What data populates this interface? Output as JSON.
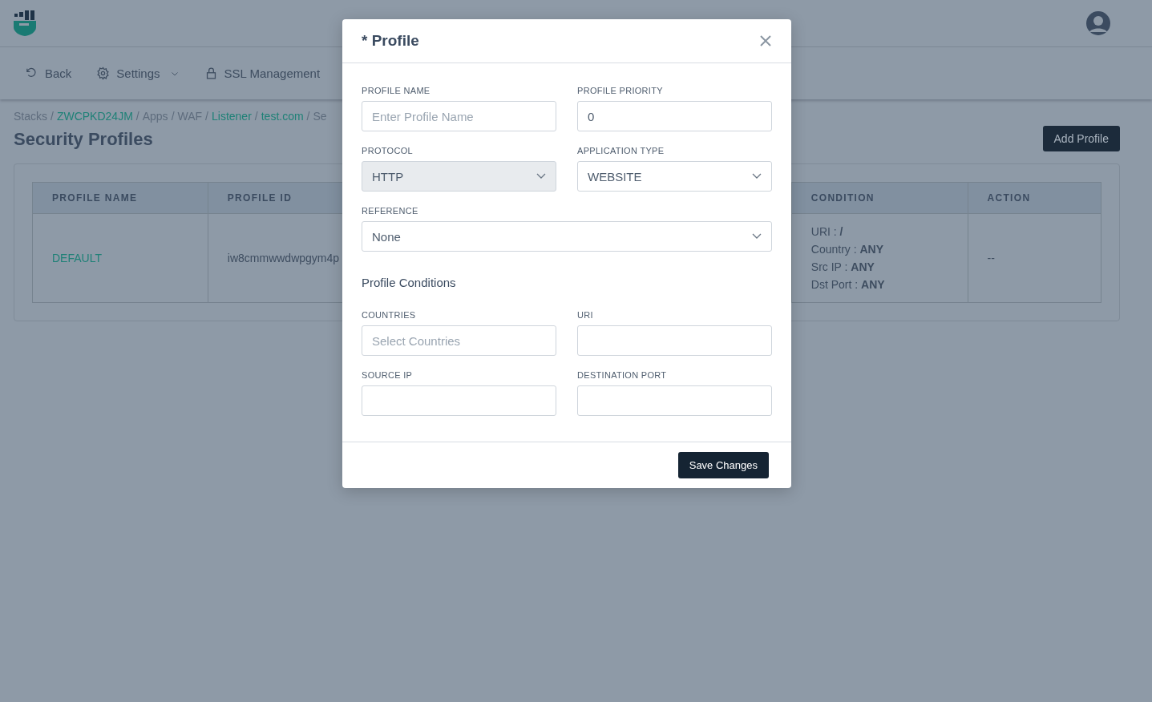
{
  "nav": [
    {
      "label": "Back",
      "dropdown": false
    },
    {
      "label": "Settings",
      "dropdown": true
    },
    {
      "label": "SSL Management",
      "dropdown": false
    }
  ],
  "breadcrumb": [
    {
      "label": "Stacks",
      "link": false
    },
    {
      "label": "ZWCPKD24JM",
      "link": true
    },
    {
      "label": "Apps",
      "link": false
    },
    {
      "label": "WAF",
      "link": false
    },
    {
      "label": "Listener",
      "link": true
    },
    {
      "label": "test.com",
      "link": true
    },
    {
      "label": "Se",
      "link": false
    }
  ],
  "breadcrumb_separators": [
    "/",
    "/",
    "/",
    "/",
    "/",
    "/"
  ],
  "page_title": "Security Profiles",
  "add_button": "Add Profile",
  "table": {
    "columns": [
      "PROFILE NAME",
      "PROFILE ID",
      "CONDITION",
      "ACTION"
    ],
    "rows": [
      {
        "name": "DEFAULT",
        "id": "iw8cmmwwdwpgym4p",
        "condition": [
          "URI : **/**",
          "Country : **ANY**",
          "Src IP : **ANY**",
          "Dst Port : **ANY**"
        ],
        "action": "--"
      }
    ]
  },
  "modal": {
    "title": "* Profile",
    "fields": [
      {
        "label": "PROFILE NAME",
        "kind": "input",
        "placeholder": "Enter Profile Name",
        "disabled": false
      },
      {
        "label": "PROFILE PRIORITY",
        "kind": "input",
        "value": "0",
        "disabled": false
      },
      {
        "label": "PROTOCOL",
        "kind": "select",
        "value": "HTTP",
        "disabled": true
      },
      {
        "label": "APPLICATION TYPE",
        "kind": "select",
        "value": "WEBSITE",
        "disabled": false
      },
      {
        "label": "REFERENCE",
        "kind": "select",
        "value": "None",
        "disabled": false,
        "wide": true
      }
    ],
    "section": "Profile Conditions",
    "conditions": [
      {
        "label": "COUNTRIES",
        "kind": "input",
        "placeholder": "Select Countries",
        "disabled": false
      },
      {
        "label": "URI",
        "kind": "input",
        "disabled": false
      },
      {
        "label": "SOURCE IP",
        "kind": "input",
        "disabled": false
      },
      {
        "label": "DESTINATION PORT",
        "kind": "input",
        "disabled": false
      }
    ],
    "save_button": "Save Changes"
  }
}
